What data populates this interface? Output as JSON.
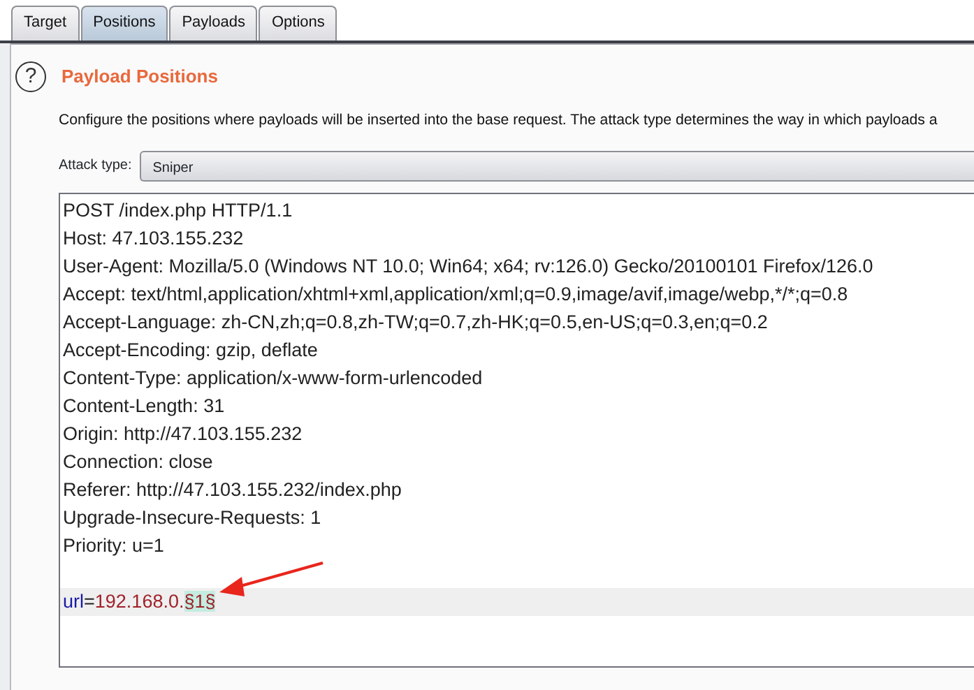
{
  "tabs": [
    {
      "label": "Target",
      "selected": false
    },
    {
      "label": "Positions",
      "selected": true
    },
    {
      "label": "Payloads",
      "selected": false
    },
    {
      "label": "Options",
      "selected": false
    }
  ],
  "section": {
    "help_icon": "?",
    "title": "Payload Positions",
    "description": "Configure the positions where payloads will be inserted into the base request. The attack type determines the way in which payloads a"
  },
  "attack_type": {
    "label": "Attack type:",
    "value": "Sniper"
  },
  "request_lines": [
    {
      "segments": [
        {
          "kind": "plain",
          "text": "POST /index.php HTTP/1.1"
        }
      ]
    },
    {
      "segments": [
        {
          "kind": "plain",
          "text": "Host: 47.103.155.232"
        }
      ]
    },
    {
      "segments": [
        {
          "kind": "plain",
          "text": "User-Agent: Mozilla/5.0 (Windows NT 10.0; Win64; x64; rv:126.0) Gecko/20100101 Firefox/126.0"
        }
      ]
    },
    {
      "segments": [
        {
          "kind": "plain",
          "text": "Accept: text/html,application/xhtml+xml,application/xml;q=0.9,image/avif,image/webp,*/*;q=0.8"
        }
      ]
    },
    {
      "segments": [
        {
          "kind": "plain",
          "text": "Accept-Language: zh-CN,zh;q=0.8,zh-TW;q=0.7,zh-HK;q=0.5,en-US;q=0.3,en;q=0.2"
        }
      ]
    },
    {
      "segments": [
        {
          "kind": "plain",
          "text": "Accept-Encoding: gzip, deflate"
        }
      ]
    },
    {
      "segments": [
        {
          "kind": "plain",
          "text": "Content-Type: application/x-www-form-urlencoded"
        }
      ]
    },
    {
      "segments": [
        {
          "kind": "plain",
          "text": "Content-Length: 31"
        }
      ]
    },
    {
      "segments": [
        {
          "kind": "plain",
          "text": "Origin: http://47.103.155.232"
        }
      ]
    },
    {
      "segments": [
        {
          "kind": "plain",
          "text": "Connection: close"
        }
      ]
    },
    {
      "segments": [
        {
          "kind": "plain",
          "text": "Referer: http://47.103.155.232/index.php"
        }
      ]
    },
    {
      "segments": [
        {
          "kind": "plain",
          "text": "Upgrade-Insecure-Requests: 1"
        }
      ]
    },
    {
      "segments": [
        {
          "kind": "plain",
          "text": "Priority: u=1"
        }
      ]
    },
    {
      "kind": "blank"
    },
    {
      "selected": true,
      "segments": [
        {
          "kind": "param",
          "text": "url"
        },
        {
          "kind": "plain",
          "text": "="
        },
        {
          "kind": "value",
          "text": "192.168.0."
        },
        {
          "kind": "marker",
          "text": "§1§"
        }
      ]
    }
  ]
}
